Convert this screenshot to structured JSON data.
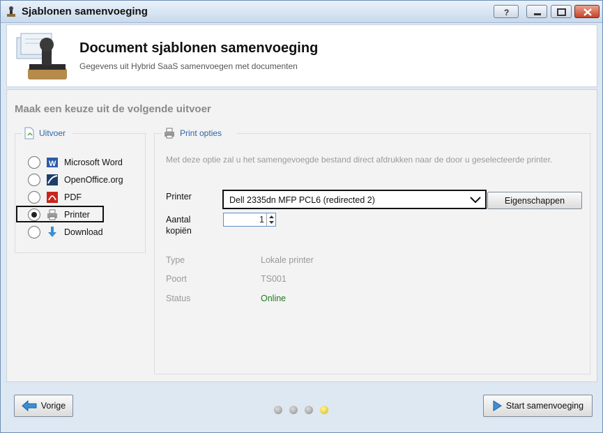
{
  "window": {
    "title": "Sjablonen samenvoeging"
  },
  "header": {
    "title": "Document sjablonen samenvoeging",
    "subtitle": "Gegevens uit Hybrid SaaS samenvoegen met documenten"
  },
  "main": {
    "section_title": "Maak een keuze uit de volgende uitvoer",
    "output_group": {
      "label": "Uitvoer",
      "options": [
        {
          "label": "Microsoft Word",
          "icon": "word-icon",
          "selected": false
        },
        {
          "label": "OpenOffice.org",
          "icon": "openoffice-icon",
          "selected": false
        },
        {
          "label": "PDF",
          "icon": "pdf-icon",
          "selected": false
        },
        {
          "label": "Printer",
          "icon": "printer-icon",
          "selected": true
        },
        {
          "label": "Download",
          "icon": "download-icon",
          "selected": false
        }
      ]
    },
    "print_options": {
      "label": "Print opties",
      "description": "Met deze optie zal u het samengevoegde bestand direct afdrukken naar de door u geselecteerde printer.",
      "printer_label": "Printer",
      "printer_value": "Dell 2335dn MFP PCL6 (redirected 2)",
      "properties_button": "Eigenschappen",
      "copies_label": "Aantal kopiën",
      "copies_value": "1",
      "info": [
        {
          "label": "Type",
          "value": "Lokale printer"
        },
        {
          "label": "Poort",
          "value": "TS001"
        },
        {
          "label": "Status",
          "value": "Online"
        }
      ]
    }
  },
  "footer": {
    "back_button": "Vorige",
    "start_button": "Start samenvoeging",
    "steps_total": 4,
    "active_step": 4
  },
  "colors": {
    "online": "#1f7a1f",
    "group_label": "#2a66a6"
  }
}
